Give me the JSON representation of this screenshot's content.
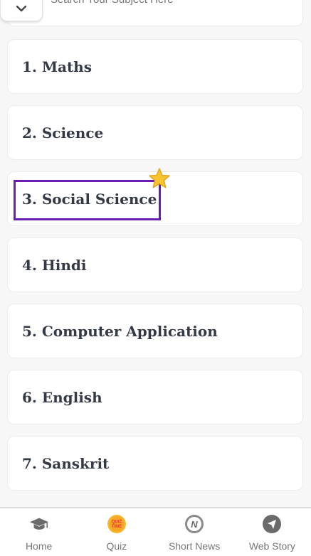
{
  "search": {
    "placeholder": "Search Your Subject Here"
  },
  "subjects": [
    {
      "label": "1. Maths"
    },
    {
      "label": "2. Science"
    },
    {
      "label": "3. Social Science"
    },
    {
      "label": "4. Hindi"
    },
    {
      "label": "5. Computer Application"
    },
    {
      "label": "6. English"
    },
    {
      "label": "7. Sanskrit"
    }
  ],
  "highlight": {
    "color": "#6a1bb0",
    "icon": "star-icon"
  },
  "bottom_nav": {
    "items": [
      {
        "label": "Home",
        "icon": "graduation-cap-icon"
      },
      {
        "label": "Quiz",
        "icon": "quiz-time-icon",
        "badge_text": "QUIZ TIME"
      },
      {
        "label": "Short News",
        "icon": "news-icon",
        "badge_text": "N"
      },
      {
        "label": "Web Story",
        "icon": "navigation-arrow-icon"
      }
    ]
  }
}
